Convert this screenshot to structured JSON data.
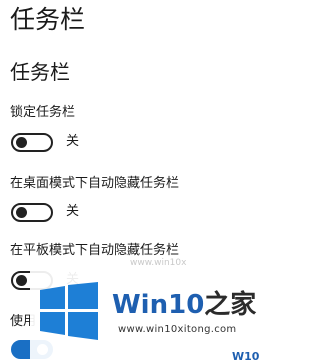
{
  "page": {
    "title": "任务栏"
  },
  "section": {
    "title": "任务栏"
  },
  "settings": [
    {
      "label": "锁定任务栏",
      "state": "关"
    },
    {
      "label": "在桌面模式下自动隐藏任务栏",
      "state": "关"
    },
    {
      "label": "在平板模式下自动隐藏任务栏",
      "state": "关"
    },
    {
      "label": "使用",
      "state": ""
    }
  ],
  "watermark": {
    "brand_prefix": "Win10",
    "brand_suffix": "之家",
    "url": "www.win10xitong.com",
    "faint_text": "www.win10x",
    "corner_text": "W10"
  },
  "colors": {
    "accent": "#1a6fc4",
    "brand": "#1e5fb0"
  }
}
